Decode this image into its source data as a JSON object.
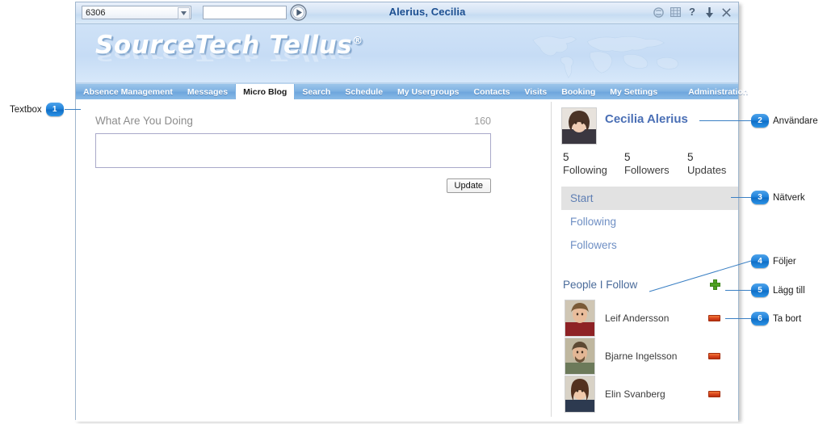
{
  "window": {
    "titlebar": {
      "combo_value": "6306",
      "combo_arrow_icon": "chevron-down-icon",
      "search_value": "",
      "search_placeholder": "",
      "go_icon": "play-circle-icon",
      "title": "Alerius, Cecilia",
      "icons": [
        {
          "name": "block-circle-icon",
          "glyph": "⃠"
        },
        {
          "name": "film-strip-icon",
          "glyph": "☷"
        },
        {
          "name": "help-icon",
          "glyph": "?"
        },
        {
          "name": "download-arrow-icon",
          "glyph": "↓"
        },
        {
          "name": "close-icon",
          "glyph": "×"
        }
      ]
    },
    "banner": {
      "brand": "SourceTech Tellus",
      "brand_registered": "®",
      "watermark": "world-map"
    },
    "nav": {
      "items": [
        {
          "label": "Absence Management",
          "active": false
        },
        {
          "label": "Messages",
          "active": false
        },
        {
          "label": "Micro Blog",
          "active": true
        },
        {
          "label": "Search",
          "active": false
        },
        {
          "label": "Schedule",
          "active": false
        },
        {
          "label": "My Usergroups",
          "active": false
        },
        {
          "label": "Contacts",
          "active": false
        },
        {
          "label": "Visits",
          "active": false
        },
        {
          "label": "Booking",
          "active": false
        },
        {
          "label": "My Settings",
          "active": false
        },
        {
          "label": "Administration",
          "active": false
        }
      ]
    },
    "blog": {
      "prompt": "What Are You Doing",
      "char_count": "160",
      "textarea_value": "",
      "textarea_placeholder": "",
      "update_label": "Update"
    },
    "profile": {
      "name": "Cecilia Alerius",
      "avatar": "cecilia-avatar",
      "stats": [
        {
          "number": "5",
          "caption": "Following"
        },
        {
          "number": "5",
          "caption": "Followers"
        },
        {
          "number": "5",
          "caption": "Updates"
        }
      ],
      "links": [
        {
          "label": "Start",
          "selected": true
        },
        {
          "label": "Following",
          "selected": false
        },
        {
          "label": "Followers",
          "selected": false
        }
      ],
      "section_title": "People I Follow",
      "add_icon": "plus-icon",
      "follow_list": [
        {
          "name": "Leif Andersson",
          "avatar": "leif-avatar",
          "remove_icon": "minus-icon"
        },
        {
          "name": "Bjarne Ingelsson",
          "avatar": "bjarne-avatar",
          "remove_icon": "minus-icon"
        },
        {
          "name": "Elin Svanberg",
          "avatar": "elin-avatar",
          "remove_icon": "minus-icon"
        }
      ]
    }
  },
  "annotations": {
    "left": [
      {
        "number": "1",
        "label": "Textbox"
      }
    ],
    "right": [
      {
        "number": "2",
        "label": "Användare"
      },
      {
        "number": "3",
        "label": "Nätverk"
      },
      {
        "number": "4",
        "label": "Följer"
      },
      {
        "number": "5",
        "label": "Lägg till"
      },
      {
        "number": "6",
        "label": "Ta bort"
      }
    ]
  },
  "colors": {
    "accent_blue": "#1e81da",
    "brand_nav": "#7fb2e2",
    "profile_name": "#4a6fb5",
    "link_blue": "#6f8fc4",
    "remove_red": "#d8421c",
    "add_green": "#4fa320"
  }
}
